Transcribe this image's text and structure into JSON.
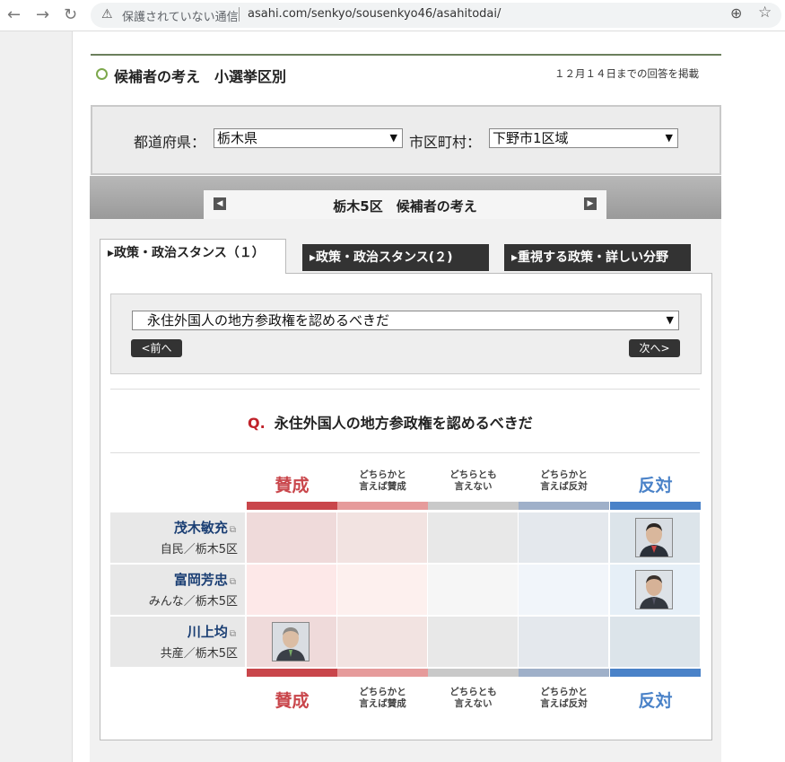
{
  "browser": {
    "insecure_label": "保護されていない通信",
    "url": "asahi.com/senkyo/sousenkyo46/asahitodai/"
  },
  "header": {
    "title": "候補者の考え　小選挙区別",
    "note": "１２月１４日までの回答を掲載"
  },
  "filters": {
    "prefecture_label": "都道府県：",
    "prefecture_value": "栃木県",
    "city_label": "市区町村：",
    "city_value": "下野市1区域"
  },
  "district_title": "栃木5区　候補者の考え",
  "tabs": [
    {
      "label": "政策・政治スタンス（１）",
      "active": true
    },
    {
      "label": "政策・政治スタンス(２)",
      "active": false
    },
    {
      "label": "重視する政策・詳しい分野",
      "active": false
    }
  ],
  "question_select": "永住外国人の地方参政権を認めるべきだ",
  "prev_button": "<前へ",
  "next_button": "次へ>",
  "question": {
    "prefix": "Q.",
    "text": "永住外国人の地方参政権を認めるべきだ"
  },
  "scale": [
    {
      "line1": "賛成",
      "line2": "",
      "color": "#c9464b"
    },
    {
      "line1": "どちらかと",
      "line2": "言えば賛成",
      "color": "#e69b9b"
    },
    {
      "line1": "どちらとも",
      "line2": "言えない",
      "color": "#c9c9c9"
    },
    {
      "line1": "どちらかと",
      "line2": "言えば反対",
      "color": "#9fb0c9"
    },
    {
      "line1": "反対",
      "line2": "",
      "color": "#4a82c8"
    }
  ],
  "candidates": [
    {
      "name": "茂木敏充",
      "party": "自民／栃木5区",
      "answer": "反対"
    },
    {
      "name": "富岡芳忠",
      "party": "みんな／栃木5区",
      "answer": "反対"
    },
    {
      "name": "川上均",
      "party": "共産／栃木5区",
      "answer": "賛成"
    }
  ]
}
